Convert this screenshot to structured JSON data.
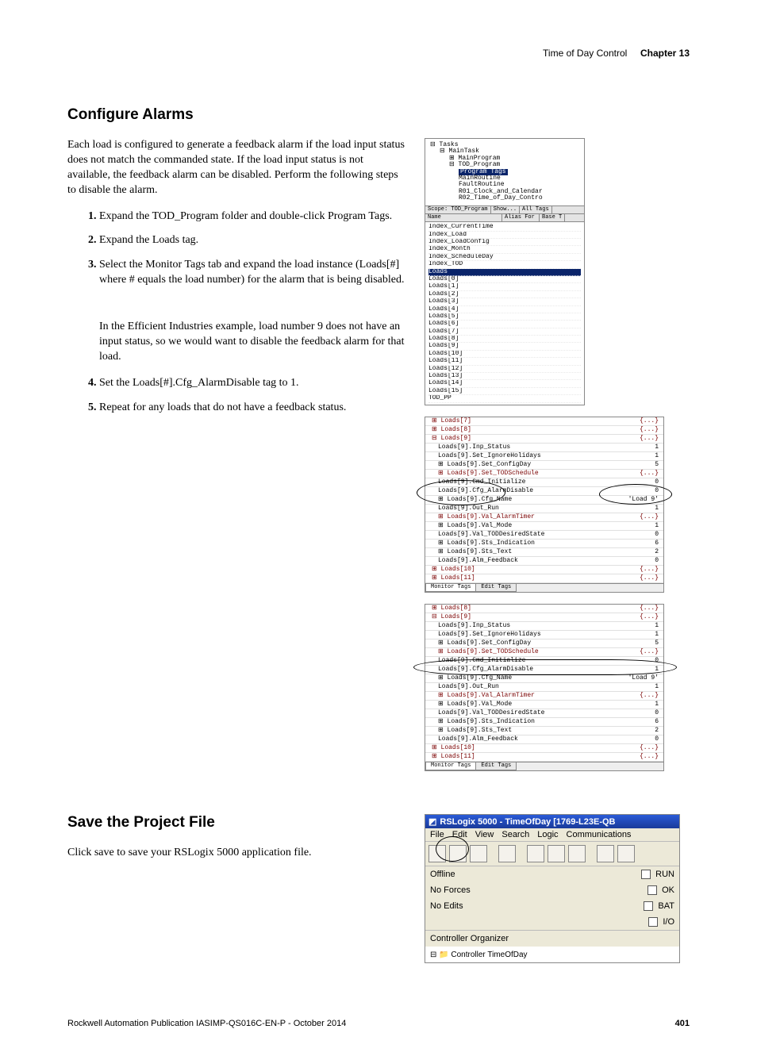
{
  "header": {
    "title": "Time of Day Control",
    "chapter": "Chapter 13"
  },
  "section1": {
    "heading": "Configure Alarms",
    "intro": "Each load is configured to generate a feedback alarm if the load input status does not match the commanded state. If the load input status is not available, the feedback alarm can be disabled. Perform the following steps to disable the alarm.",
    "steps": {
      "s1": "Expand the TOD_Program folder and double-click Program Tags.",
      "s2": "Expand the Loads tag.",
      "s3": "Select the Monitor Tags tab and expand the load instance (Loads[#] where # equals the load number) for the alarm that is being disabled.",
      "note": "In the Efficient Industries example, load number 9 does not have an input status, so we would want to disable the feedback alarm for that load.",
      "s4": "Set the Loads[#].Cfg_AlarmDisable tag to 1.",
      "s5": "Repeat for any loads that do not have a feedback status."
    }
  },
  "tree_shot": {
    "root": "Tasks",
    "items": [
      "MainTask",
      "MainProgram",
      "TOD_Program",
      "Program Tags",
      "MainRoutine",
      "FaultRoutine",
      "R01_Clock_and_Calendar",
      "R02_Time_of_Day_Contro"
    ],
    "scope_label": "Scope:",
    "scope_value": "TOD_Program",
    "show_label": "Show...",
    "show_value": "All Tags",
    "col1": "Name",
    "col2": "Alias For",
    "col3": "Base T",
    "rows": [
      "Index_CurrentTime",
      "Index_Load",
      "Index_LoadConfig",
      "Index_Month",
      "Index_ScheduleDay",
      "Index_TOD",
      "Loads",
      "Loads[0]",
      "Loads[1]",
      "Loads[2]",
      "Loads[3]",
      "Loads[4]",
      "Loads[5]",
      "Loads[6]",
      "Loads[7]",
      "Loads[8]",
      "Loads[9]",
      "Loads[10]",
      "Loads[11]",
      "Loads[12]",
      "Loads[13]",
      "Loads[14]",
      "Loads[15]",
      "TOD_PP"
    ]
  },
  "loads_shot_a": {
    "top0": {
      "n": "Loads[7]",
      "v": "{...}"
    },
    "top1": {
      "n": "Loads[8]",
      "v": "{...}"
    },
    "top2": {
      "n": "Loads[9]",
      "v": "{...}"
    },
    "rows": [
      {
        "n": "Loads[9].Inp_Status",
        "v": "1"
      },
      {
        "n": "Loads[9].Set_IgnoreHolidays",
        "v": "1"
      },
      {
        "n": "Loads[9].Set_ConfigDay",
        "v": "5"
      },
      {
        "n": "Loads[9].Set_TODSchedule",
        "v": "{...}"
      },
      {
        "n": "Loads[9].Cmd_Initialize",
        "v": "0"
      },
      {
        "n": "Loads[9].Cfg_AlarmDisable",
        "v": "0"
      },
      {
        "n": "Loads[9].Cfg_Name",
        "v": "'Load 9'"
      },
      {
        "n": "Loads[9].Out_Run",
        "v": "1"
      },
      {
        "n": "Loads[9].Val_AlarmTimer",
        "v": "{...}"
      },
      {
        "n": "Loads[9].Val_Mode",
        "v": "1"
      },
      {
        "n": "Loads[9].Val_TODDesiredState",
        "v": "0"
      },
      {
        "n": "Loads[9].Sts_Indication",
        "v": "6"
      },
      {
        "n": "Loads[9].Sts_Text",
        "v": "2"
      },
      {
        "n": "Loads[9].Alm_Feedback",
        "v": "0"
      }
    ],
    "bot0": {
      "n": "Loads[10]",
      "v": "{...}"
    },
    "bot1": {
      "n": "Loads[11]",
      "v": "{...}"
    },
    "tab1": "Monitor Tags",
    "tab2": "Edit Tags"
  },
  "loads_shot_b": {
    "top0": {
      "n": "Loads[8]",
      "v": "{...}"
    },
    "top1": {
      "n": "Loads[9]",
      "v": "{...}"
    },
    "rows": [
      {
        "n": "Loads[9].Inp_Status",
        "v": "1"
      },
      {
        "n": "Loads[9].Set_IgnoreHolidays",
        "v": "1"
      },
      {
        "n": "Loads[9].Set_ConfigDay",
        "v": "5"
      },
      {
        "n": "Loads[9].Set_TODSchedule",
        "v": "{...}"
      },
      {
        "n": "Loads[9].Cmd_Initialize",
        "v": "0"
      },
      {
        "n": "Loads[9].Cfg_AlarmDisable",
        "v": "1"
      },
      {
        "n": "Loads[9].Cfg_Name",
        "v": "'Load 9'"
      },
      {
        "n": "Loads[9].Out_Run",
        "v": "1"
      },
      {
        "n": "Loads[9].Val_AlarmTimer",
        "v": "{...}"
      },
      {
        "n": "Loads[9].Val_Mode",
        "v": "1"
      },
      {
        "n": "Loads[9].Val_TODDesiredState",
        "v": "0"
      },
      {
        "n": "Loads[9].Sts_Indication",
        "v": "6"
      },
      {
        "n": "Loads[9].Sts_Text",
        "v": "2"
      },
      {
        "n": "Loads[9].Alm_Feedback",
        "v": "0"
      }
    ],
    "bot0": {
      "n": "Loads[10]",
      "v": "{...}"
    },
    "bot1": {
      "n": "Loads[11]",
      "v": "{...}"
    },
    "tab1": "Monitor Tags",
    "tab2": "Edit Tags"
  },
  "section2": {
    "heading": "Save the Project File",
    "text": "Click save to save your RSLogix 5000 application file."
  },
  "rslogix": {
    "title": "RSLogix 5000 - TimeOfDay [1769-L23E-QB",
    "menus": [
      "File",
      "Edit",
      "View",
      "Search",
      "Logic",
      "Communications"
    ],
    "status": {
      "offline": "Offline",
      "noforces": "No Forces",
      "noedits": "No Edits",
      "run": "RUN",
      "ok": "OK",
      "bat": "BAT",
      "io": "I/O"
    },
    "organizer": "Controller Organizer",
    "controller": "Controller TimeOfDay"
  },
  "footer": {
    "pub": "Rockwell Automation Publication IASIMP-QS016C-EN-P - October 2014",
    "page": "401"
  }
}
